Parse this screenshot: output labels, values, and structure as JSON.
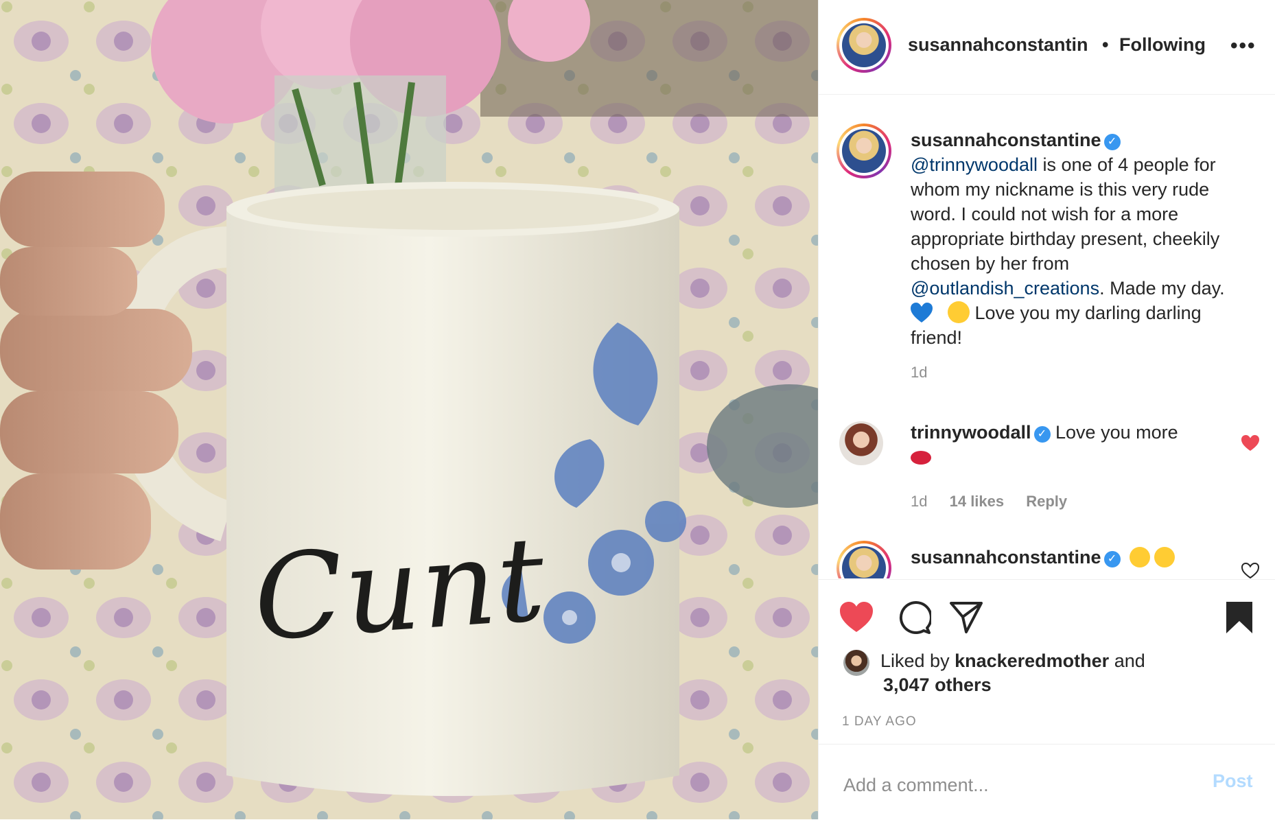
{
  "post": {
    "author": "susannahconstantin",
    "follow_separator": "•",
    "follow_status": "Following",
    "more_icon": "more-options-icon"
  },
  "photo": {
    "mug_text": "Cunt"
  },
  "caption": {
    "username": "susannahconstantine",
    "verified_mark": "✓",
    "mention1": "@trinnywoodall",
    "text1": " is one of 4 people for whom my nickname is this very rude word. I could not wish for a more appropriate birthday present, cheekily chosen by her from ",
    "mention2": "@outlandish_creations",
    "text2": ". Made my day.",
    "text3": " Love you my darling darling friend!",
    "time": "1d"
  },
  "reply1": {
    "username": "trinnywoodall",
    "verified_mark": "✓",
    "text": "Love you more",
    "time": "1d",
    "likes": "14 likes",
    "reply_label": "Reply"
  },
  "reply2": {
    "username": "susannahconstantine",
    "verified_mark": "✓"
  },
  "engagement": {
    "liked_by_prefix": "Liked by ",
    "liked_by_user": "knackeredmother",
    "liked_by_suffix": " and",
    "others": "3,047 others",
    "time_ago": "1 DAY AGO"
  },
  "comment_box": {
    "placeholder": "Add a comment...",
    "post_label": "Post"
  },
  "colors": {
    "like_red": "#ed4956",
    "verified_blue": "#3897f0",
    "mention_blue": "#00376b",
    "post_disabled": "#b3dbff"
  }
}
